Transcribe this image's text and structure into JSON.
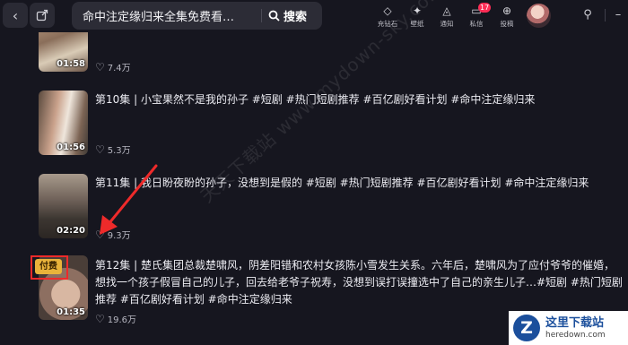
{
  "nav": {
    "back_icon": "chevron-left-icon",
    "new_window_icon": "new-window-icon"
  },
  "search": {
    "query": "命中注定缘归来全集免费看…",
    "button_label": "搜索"
  },
  "toolbar": [
    {
      "label": "充钻石",
      "icon": "diamond-icon"
    },
    {
      "label": "壁纸",
      "icon": "wallpaper-icon"
    },
    {
      "label": "通知",
      "icon": "bell-icon"
    },
    {
      "label": "私信",
      "icon": "message-icon",
      "badge": "17"
    },
    {
      "label": "投稿",
      "icon": "upload-icon"
    }
  ],
  "episodes": [
    {
      "duration": "01:58",
      "likes": "7.4万",
      "title": ""
    },
    {
      "duration": "01:56",
      "likes": "5.3万",
      "title": "第10集 | 小宝果然不是我的孙子 #短剧 #热门短剧推荐 #百亿剧好看计划 #命中注定缘归来"
    },
    {
      "duration": "02:20",
      "likes": "9.3万",
      "title": "第11集 | 我日盼夜盼的孙子，没想到是假的 #短剧 #热门短剧推荐 #百亿剧好看计划 #命中注定缘归来"
    },
    {
      "duration": "01:35",
      "likes": "19.6万",
      "title": "第12集 | 楚氏集团总裁楚啸风，阴差阳错和农村女孩陈小雪发生关系。六年后，楚啸风为了应付爷爷的催婚，想找一个孩子假冒自己的儿子，回去给老爷子祝寿，没想到误打误撞选中了自己的亲生儿子…#短剧 #热门短剧推荐 #百亿剧好看计划 #命中注定缘归来",
      "paid_label": "付费"
    }
  ],
  "watermark": "天天下载站 www.mydown-sky.com",
  "brand": {
    "name": "这里下载站",
    "url": "heredown.com",
    "logo_letter": "Z"
  },
  "colors": {
    "background": "#16161f",
    "accent_red": "#ee2a2a",
    "badge": "#fe2c55",
    "paid": "#e9b33a"
  }
}
